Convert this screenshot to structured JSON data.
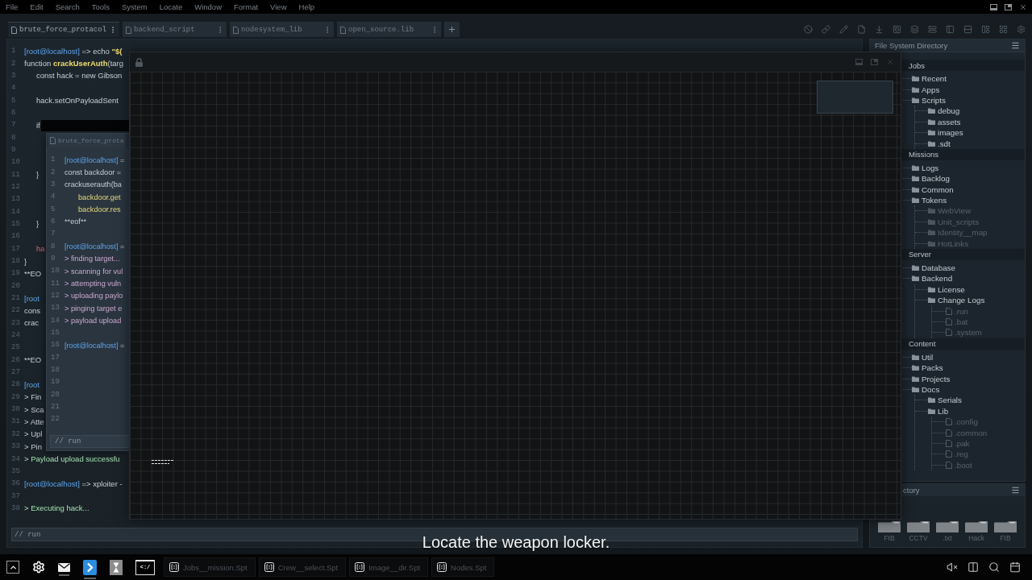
{
  "menu": [
    "File",
    "Edit",
    "Search",
    "Tools",
    "System",
    "Locate",
    "Window",
    "Format",
    "View",
    "Help"
  ],
  "tabs": [
    {
      "label": "brute_force_protacol",
      "selected": true
    },
    {
      "label": "backend_script",
      "selected": false
    },
    {
      "label": "nodesystem_lib",
      "selected": false
    },
    {
      "label": "open_source.lib",
      "selected": false
    }
  ],
  "editor": {
    "lines": [
      {
        "number": "1",
        "segments": [
          {
            "kind": "prompt",
            "text": "[root@localhost]"
          },
          {
            "kind": "plain",
            "text": " => echo "
          },
          {
            "kind": "string",
            "text": "\"$("
          }
        ]
      },
      {
        "number": "2",
        "segments": [
          {
            "kind": "plain",
            "text": "function "
          },
          {
            "kind": "func",
            "text": "crackUserAuth"
          },
          {
            "kind": "plain",
            "text": "(targ"
          }
        ],
        "children": [
          {
            "number": "3",
            "segments": [
              {
                "kind": "plain",
                "text": "const hack = new Gibson"
              }
            ]
          },
          {
            "number": "4"
          },
          {
            "number": "5",
            "segments": [
              {
                "kind": "plain",
                "text": "hack.setOnPayloadSent"
              }
            ]
          },
          {
            "number": "6"
          },
          {
            "number": "7",
            "segments": [
              {
                "kind": "plain",
                "text": "if"
              },
              {
                "kind": "redaction"
              }
            ]
          },
          {
            "number": "8"
          },
          {
            "number": "9"
          },
          {
            "number": "10"
          },
          {
            "number": "11",
            "segments": [
              {
                "kind": "plain",
                "text": "}"
              }
            ]
          },
          {
            "number": "12"
          },
          {
            "number": "13"
          },
          {
            "number": "14"
          },
          {
            "number": "15",
            "segments": [
              {
                "kind": "plain",
                "text": "}"
              }
            ]
          },
          {
            "number": "16"
          },
          {
            "number": "17",
            "segments": [
              {
                "kind": "error",
                "text": "ha"
              }
            ]
          }
        ]
      },
      {
        "number": "18",
        "segments": [
          {
            "kind": "plain",
            "text": "}"
          }
        ]
      },
      {
        "number": "19",
        "segments": [
          {
            "kind": "plain",
            "text": "**EO"
          }
        ]
      },
      {
        "number": "20"
      },
      {
        "number": "21",
        "segments": [
          {
            "kind": "prompt",
            "text": "[root"
          }
        ]
      },
      {
        "number": "22",
        "segments": [
          {
            "kind": "plain",
            "text": "cons"
          }
        ]
      },
      {
        "number": "23",
        "segments": [
          {
            "kind": "plain",
            "text": "crac"
          }
        ]
      },
      {
        "number": "24"
      },
      {
        "number": "25"
      },
      {
        "number": "26",
        "segments": [
          {
            "kind": "plain",
            "text": "**EO"
          }
        ]
      },
      {
        "number": "27"
      },
      {
        "number": "28",
        "segments": [
          {
            "kind": "prompt",
            "text": "[root"
          }
        ]
      },
      {
        "number": "29",
        "segments": [
          {
            "kind": "plain",
            "text": "> Fin"
          }
        ]
      },
      {
        "number": "30",
        "segments": [
          {
            "kind": "plain",
            "text": "> Sca"
          }
        ]
      },
      {
        "number": "31",
        "segments": [
          {
            "kind": "plain",
            "text": "> Atte"
          }
        ]
      },
      {
        "number": "32",
        "segments": [
          {
            "kind": "plain",
            "text": "> Upl"
          }
        ]
      },
      {
        "number": "33",
        "segments": [
          {
            "kind": "plain",
            "text": "> Pin"
          }
        ]
      },
      {
        "number": "34",
        "segments": [
          {
            "kind": "success",
            "text": "> Payload upload successfu"
          }
        ]
      },
      {
        "number": "35"
      },
      {
        "number": "36",
        "segments": [
          {
            "kind": "prompt",
            "text": "[root@localhost]"
          },
          {
            "kind": "plain",
            "text": " => xploiter -"
          }
        ]
      },
      {
        "number": "37"
      },
      {
        "number": "38",
        "segments": [
          {
            "kind": "success",
            "text": "> Executing hack..."
          }
        ]
      }
    ],
    "command_input": {
      "placeholder": "// run"
    }
  },
  "editor_window": {
    "tab": "brute_force_prota",
    "lines": [
      {
        "number": "1",
        "segments": [
          {
            "kind": "prompt",
            "text": "[root@localhost]"
          },
          {
            "kind": "plain",
            "text": " ="
          }
        ]
      },
      {
        "number": "2",
        "segments": [
          {
            "kind": "plain",
            "text": "const backdoor ="
          }
        ]
      },
      {
        "number": "3",
        "segments": [
          {
            "kind": "plain",
            "text": "crackuserauth(ba"
          }
        ],
        "children": [
          {
            "number": "4",
            "segments": [
              {
                "kind": "method",
                "text": "backdoor.get"
              }
            ]
          },
          {
            "number": "5",
            "segments": [
              {
                "kind": "method",
                "text": "backdoor.res"
              }
            ]
          }
        ]
      },
      {
        "number": "6",
        "segments": [
          {
            "kind": "plain",
            "text": "**eof**"
          }
        ]
      },
      {
        "number": "7"
      },
      {
        "number": "8",
        "segments": [
          {
            "kind": "prompt",
            "text": "[root@localhost]"
          },
          {
            "kind": "plain",
            "text": " ="
          }
        ]
      },
      {
        "number": "9",
        "segments": [
          {
            "kind": "log",
            "text": "> finding target..."
          }
        ]
      },
      {
        "number": "10",
        "segments": [
          {
            "kind": "log",
            "text": "> scanning for vul"
          }
        ]
      },
      {
        "number": "11",
        "segments": [
          {
            "kind": "log",
            "text": "> attempting vuln"
          }
        ]
      },
      {
        "number": "12",
        "segments": [
          {
            "kind": "log",
            "text": "> uploading paylo"
          }
        ]
      },
      {
        "number": "13",
        "segments": [
          {
            "kind": "log",
            "text": "> pinging target e"
          }
        ]
      },
      {
        "number": "14",
        "segments": [
          {
            "kind": "log",
            "text": "> payload upload"
          }
        ]
      },
      {
        "number": "15"
      },
      {
        "number": "16",
        "segments": [
          {
            "kind": "prompt",
            "text": "[root@localhost]"
          },
          {
            "kind": "plain",
            "text": " ="
          }
        ]
      },
      {
        "number": "17"
      },
      {
        "number": "18"
      },
      {
        "number": "19"
      },
      {
        "number": "20"
      },
      {
        "number": "21"
      },
      {
        "number": "22"
      }
    ],
    "command_input": {
      "placeholder": "// run"
    }
  },
  "file_system": {
    "title": "File System Directory",
    "sections": [
      {
        "label": "Jobs",
        "children": [
          {
            "label": "Recent",
            "kind": "folder",
            "dimmed": false
          },
          {
            "label": "Apps",
            "kind": "folder",
            "dimmed": false
          },
          {
            "label": "Scripts",
            "kind": "folder",
            "dimmed": false,
            "children": [
              {
                "label": "debug",
                "kind": "folder",
                "dimmed": false
              },
              {
                "label": "assets",
                "kind": "folder",
                "dimmed": false
              },
              {
                "label": "images",
                "kind": "folder",
                "dimmed": false
              },
              {
                "label": ".sdt",
                "kind": "folder",
                "dimmed": false
              }
            ]
          }
        ]
      },
      {
        "label": "Missions",
        "children": [
          {
            "label": "Logs",
            "kind": "folder",
            "dimmed": false
          },
          {
            "label": "Backlog",
            "kind": "folder",
            "dimmed": false
          },
          {
            "label": "Common",
            "kind": "folder",
            "dimmed": false
          },
          {
            "label": "Tokens",
            "kind": "folder",
            "dimmed": false,
            "children": [
              {
                "label": "WebView",
                "kind": "folder",
                "dimmed": true
              },
              {
                "label": "Unit_scripts",
                "kind": "folder",
                "dimmed": true
              },
              {
                "label": "Identity__map",
                "kind": "folder",
                "dimmed": true
              },
              {
                "label": "HotLinks",
                "kind": "folder",
                "dimmed": true
              }
            ]
          }
        ]
      },
      {
        "label": "Server",
        "children": [
          {
            "label": "Database",
            "kind": "folder",
            "dimmed": false
          },
          {
            "label": "Backend",
            "kind": "folder",
            "dimmed": false,
            "children": [
              {
                "label": "License",
                "kind": "folder",
                "dimmed": false
              },
              {
                "label": "Change Logs",
                "kind": "folder",
                "dimmed": false,
                "children": [
                  {
                    "label": ".run",
                    "kind": "file",
                    "dimmed": true
                  },
                  {
                    "label": ".bat",
                    "kind": "file",
                    "dimmed": true
                  },
                  {
                    "label": ".system",
                    "kind": "file",
                    "dimmed": true
                  }
                ]
              }
            ]
          }
        ]
      },
      {
        "label": "Content",
        "children": [
          {
            "label": "Util",
            "kind": "folder",
            "dimmed": false
          },
          {
            "label": "Packs",
            "kind": "folder",
            "dimmed": false
          },
          {
            "label": "Projects",
            "kind": "folder",
            "dimmed": false
          },
          {
            "label": "Docs",
            "kind": "folder",
            "dimmed": false,
            "children": [
              {
                "label": "Serials",
                "kind": "folder",
                "dimmed": false
              },
              {
                "label": "Lib",
                "kind": "folder",
                "dimmed": false,
                "children": [
                  {
                    "label": ".config",
                    "kind": "file",
                    "dimmed": true
                  },
                  {
                    "label": ".common",
                    "kind": "file",
                    "dimmed": true
                  },
                  {
                    "label": ".pak",
                    "kind": "file",
                    "dimmed": true
                  },
                  {
                    "label": ".reg",
                    "kind": "file",
                    "dimmed": true
                  },
                  {
                    "label": ".boot",
                    "kind": "file",
                    "dimmed": true
                  }
                ]
              }
            ]
          }
        ]
      }
    ]
  },
  "shortcuts": {
    "title": "ctory",
    "items": [
      {
        "label": "FIB"
      },
      {
        "label": "CCTV"
      },
      {
        "label": ".txt"
      },
      {
        "label": "Hack"
      },
      {
        "label": "FIB"
      }
    ]
  },
  "subtitle": "Locate the weapon locker.",
  "taskbar": {
    "launchers": [
      {
        "kind": "expand",
        "running": false
      },
      {
        "kind": "settings",
        "running": false
      },
      {
        "kind": "mail",
        "running": true
      },
      {
        "kind": "app",
        "running": true
      },
      {
        "kind": "hourglass",
        "running": false
      },
      {
        "kind": "terminal",
        "label": "<:/",
        "running": false
      }
    ],
    "tasks": [
      {
        "label": "Jobs__mission.Spt"
      },
      {
        "label": "Crew__select.Spt"
      },
      {
        "label": "Image__dir.Spt"
      },
      {
        "label": "Nodes.Spt"
      }
    ]
  }
}
